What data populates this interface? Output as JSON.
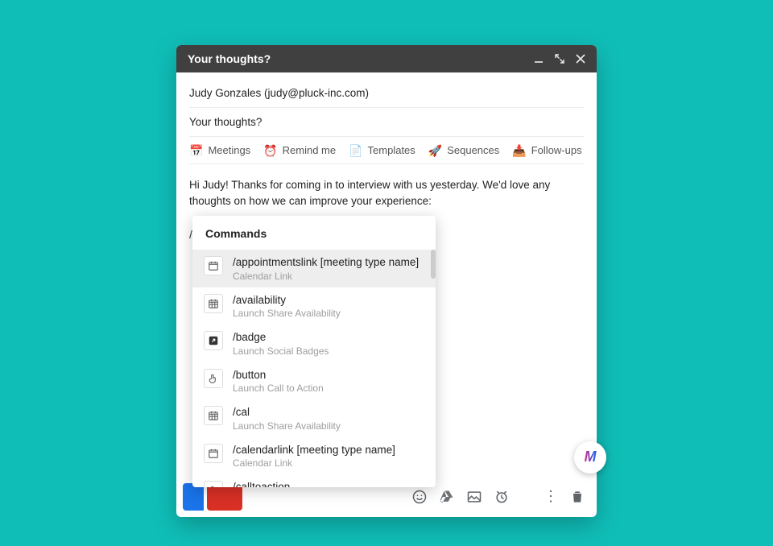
{
  "header": {
    "title": "Your thoughts?"
  },
  "to": {
    "value": "Judy Gonzales (judy@pluck-inc.com)"
  },
  "subject": {
    "value": "Your thoughts?"
  },
  "toolbar": {
    "meetings": "Meetings",
    "remind": "Remind me",
    "templates": "Templates",
    "sequences": "Sequences",
    "followups": "Follow-ups"
  },
  "message": {
    "text": "Hi Judy! Thanks for coming in to interview with us yesterday. We'd love any thoughts on how we can improve your experience:",
    "slash": "/"
  },
  "commands": {
    "heading": "Commands",
    "items": [
      {
        "icon": "calendar-blank",
        "title": "/appointmentslink [meeting type name]",
        "desc": "Calendar Link",
        "highlight": true
      },
      {
        "icon": "calendar-grid",
        "title": "/availability",
        "desc": "Launch Share Availability"
      },
      {
        "icon": "external",
        "title": "/badge",
        "desc": "Launch Social Badges"
      },
      {
        "icon": "pointer",
        "title": "/button",
        "desc": "Launch Call to Action"
      },
      {
        "icon": "calendar-grid",
        "title": "/cal",
        "desc": "Launch Share Availability"
      },
      {
        "icon": "calendar-blank",
        "title": "/calendarlink [meeting type name]",
        "desc": "Calendar Link"
      },
      {
        "icon": "pointer",
        "title": "/calltoaction",
        "desc": ""
      }
    ]
  },
  "fab": {
    "text": "M"
  }
}
